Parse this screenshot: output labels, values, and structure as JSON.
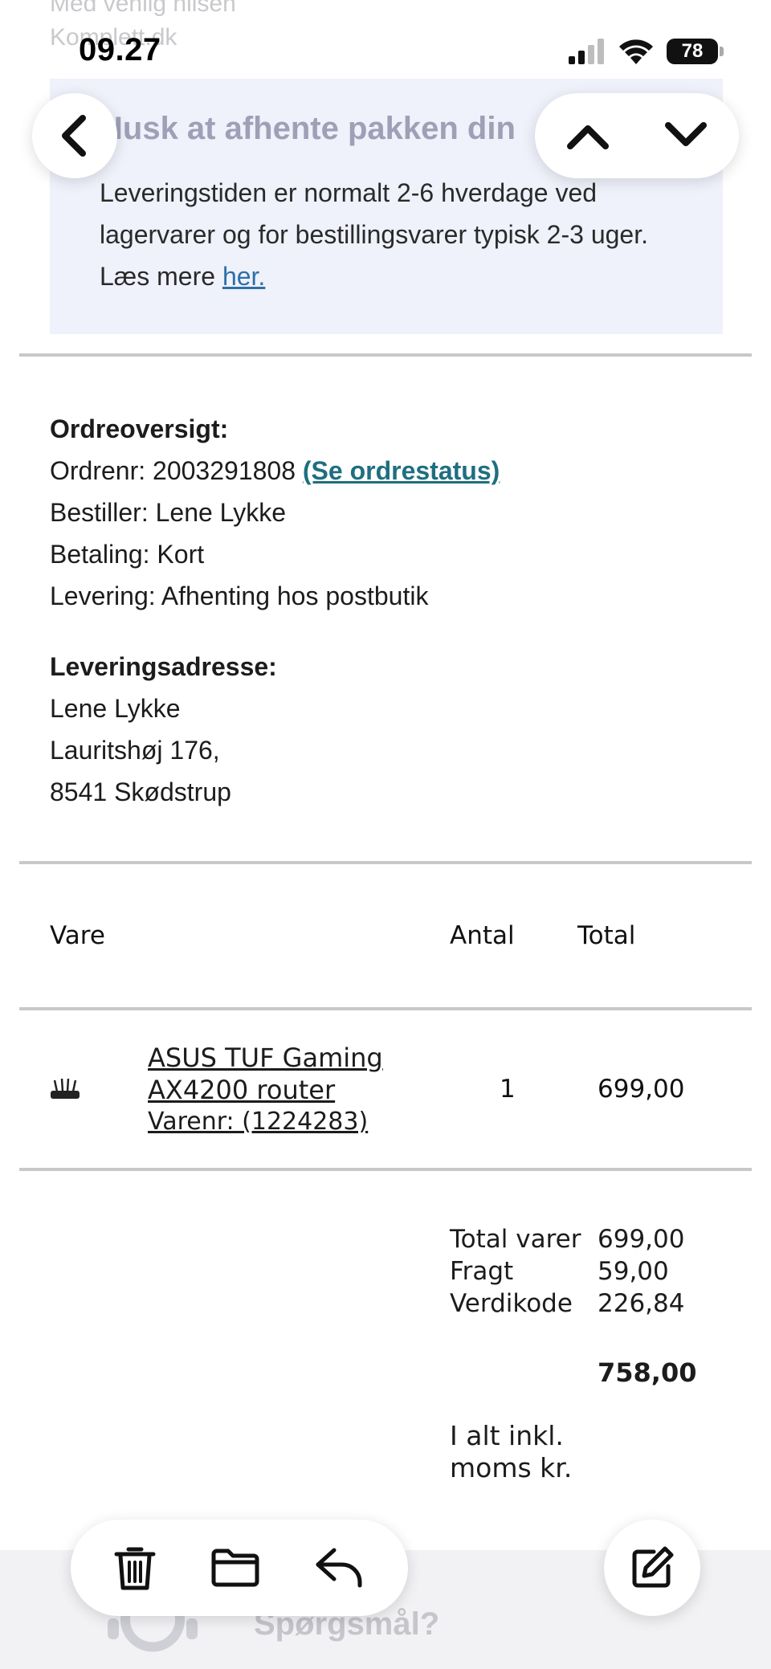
{
  "ghost": {
    "line1": "Med venlig hilsen",
    "line2": "Komplett.dk"
  },
  "status_bar": {
    "time": "09.27",
    "battery": "78"
  },
  "notice": {
    "title": "Husk at afhente pakken din",
    "text": "Leveringstiden er normalt 2-6 hverdage ved lagervarer og for bestillingsvarer typisk 2-3 uger. Læs mere",
    "link": "her."
  },
  "order": {
    "heading": "Ordreoversigt:",
    "order_no_label": "Ordrenr: 2003291808",
    "status_link": "(Se ordrestatus)",
    "customer": "Bestiller: Lene Lykke",
    "payment": "Betaling: Kort",
    "delivery": "Levering: Afhenting hos postbutik"
  },
  "address": {
    "heading": "Leveringsadresse:",
    "name": "Lene Lykke",
    "street": "Lauritshøj 176,",
    "city": "8541 Skødstrup"
  },
  "table": {
    "headers": {
      "item": "Vare",
      "qty": "Antal",
      "total": "Total"
    },
    "rows": [
      {
        "name": "ASUS TUF Gaming AX4200 router",
        "sku": "Varenr: (1224283)",
        "qty": "1",
        "total": "699,00"
      }
    ]
  },
  "summary": {
    "labels": "Total varer Fragt Verdikode",
    "values": [
      "699,00",
      "59,00",
      "226,84"
    ],
    "grand_total": "758,00",
    "incl_label": "I alt inkl. moms kr."
  },
  "footer": {
    "question": "Spørgsmål?"
  },
  "icons": {
    "back": "chevron-left-icon",
    "up": "chevron-up-icon",
    "down": "chevron-down-icon",
    "trash": "trash-icon",
    "folder": "folder-icon",
    "reply": "reply-icon",
    "compose": "compose-icon"
  }
}
